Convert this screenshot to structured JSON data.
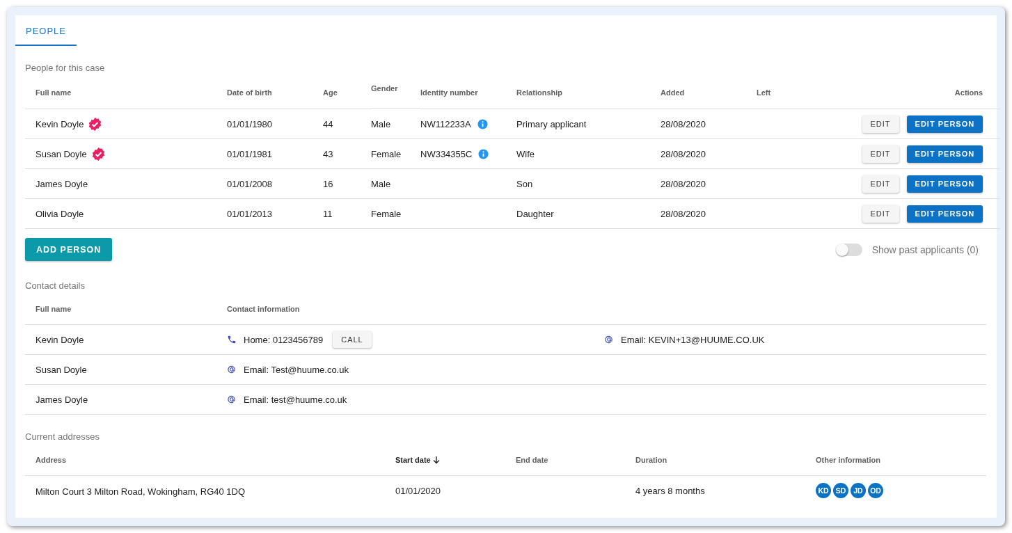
{
  "tabs": [
    {
      "label": "PEOPLE",
      "selected": true
    }
  ],
  "people": {
    "title": "People for this case",
    "columns": [
      "Full name",
      "Date of birth",
      "Age",
      "Gender",
      "Identity number",
      "Relationship",
      "Added",
      "Left",
      "Actions"
    ],
    "rows": [
      {
        "name": "Kevin Doyle",
        "verified": true,
        "dob": "01/01/1980",
        "age": "44",
        "gender": "Male",
        "identity": "NW112233A",
        "relationship": "Primary applicant",
        "added": "28/08/2020",
        "left": "",
        "actions": [
          "EDIT",
          "EDIT PERSON"
        ]
      },
      {
        "name": "Susan Doyle",
        "verified": true,
        "dob": "01/01/1981",
        "age": "43",
        "gender": "Female",
        "identity": "NW334355C",
        "relationship": "Wife",
        "added": "28/08/2020",
        "left": "",
        "actions": [
          "EDIT",
          "EDIT PERSON"
        ]
      },
      {
        "name": "James Doyle",
        "verified": false,
        "dob": "01/01/2008",
        "age": "16",
        "gender": "Male",
        "identity": "",
        "relationship": "Son",
        "added": "28/08/2020",
        "left": "",
        "actions": [
          "EDIT",
          "EDIT PERSON"
        ]
      },
      {
        "name": "Olivia Doyle",
        "verified": false,
        "dob": "01/01/2013",
        "age": "11",
        "gender": "Female",
        "identity": "",
        "relationship": "Daughter",
        "added": "28/08/2020",
        "left": "",
        "actions": [
          "EDIT",
          "EDIT PERSON"
        ]
      }
    ],
    "add_button": "ADD PERSON",
    "toggle": {
      "label": "Show past applicants (0)",
      "on": false
    }
  },
  "contacts": {
    "title": "Contact details",
    "columns": [
      "Full name",
      "Contact information"
    ],
    "rows": [
      {
        "name": "Kevin Doyle",
        "items": [
          {
            "kind": "phone",
            "text": "Home: 0123456789",
            "button": "CALL"
          },
          {
            "kind": "email",
            "text": "Email: KEVIN+13@HUUME.CO.UK"
          }
        ]
      },
      {
        "name": "Susan Doyle",
        "items": [
          {
            "kind": "email",
            "text": "Email: Test@huume.co.uk"
          }
        ]
      },
      {
        "name": "James Doyle",
        "items": [
          {
            "kind": "email",
            "text": "Email: test@huume.co.uk"
          }
        ]
      }
    ]
  },
  "addresses": {
    "title": "Current addresses",
    "columns": [
      {
        "label": "Address",
        "sorted": false
      },
      {
        "label": "Start date",
        "sorted": true
      },
      {
        "label": "End date",
        "sorted": false
      },
      {
        "label": "Duration",
        "sorted": false
      },
      {
        "label": "Other information",
        "sorted": false
      }
    ],
    "rows": [
      {
        "address": "Milton Court 3 Milton Road, Wokingham, RG40 1DQ",
        "start": "01/01/2020",
        "end": "",
        "duration": "4 years 8 months",
        "people": [
          "KD",
          "SD",
          "JD",
          "OD"
        ]
      }
    ]
  }
}
